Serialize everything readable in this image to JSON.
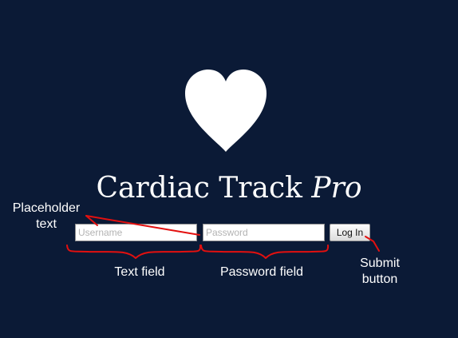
{
  "app": {
    "title_main": "Cardiac Track",
    "title_suffix": "Pro",
    "logo_icon": "heart-icon",
    "background_color": "#0b1a36",
    "annotation_color": "#e3100f"
  },
  "login_form": {
    "username_placeholder": "Username",
    "username_value": "",
    "password_placeholder": "Password",
    "password_value": "",
    "submit_label": "Log In"
  },
  "annotations": {
    "placeholder_text": "Placeholder text",
    "text_field": "Text field",
    "password_field": "Password field",
    "submit_button": "Submit button"
  }
}
